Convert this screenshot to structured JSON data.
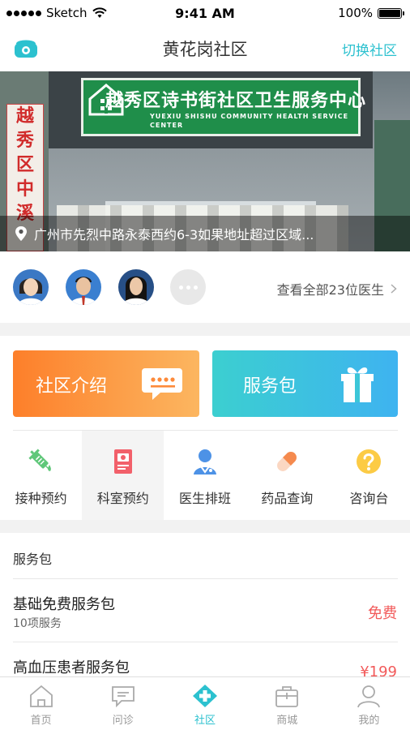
{
  "status_bar": {
    "carrier": "Sketch",
    "time": "9:41 AM",
    "battery": "100%"
  },
  "nav": {
    "title": "黄花岗社区",
    "switch_label": "切换社区",
    "phone_icon": "phone-icon"
  },
  "banner": {
    "address": "广州市先烈中路永泰西约6-3如果地址超过区域...",
    "sign_cn": "越秀区诗书街社区卫生服务中心",
    "sign_en": "YUEXIU SHISHU COMMUNITY HEALTH SERVICE CENTER",
    "side_banner": [
      "越",
      "秀",
      "区",
      "中",
      "溪"
    ]
  },
  "doctors": {
    "see_all": "查看全部23位医生"
  },
  "cards": {
    "intro_label": "社区介绍",
    "package_label": "服务包"
  },
  "menu": [
    {
      "label": "接种预约",
      "icon": "syringe-icon"
    },
    {
      "label": "科室预约",
      "icon": "notebook-icon"
    },
    {
      "label": "医生排班",
      "icon": "doctor-icon"
    },
    {
      "label": "药品查询",
      "icon": "pill-icon"
    },
    {
      "label": "咨询台",
      "icon": "question-icon"
    }
  ],
  "services": {
    "section_title": "服务包",
    "items": [
      {
        "name": "基础免费服务包",
        "sub": "10项服务",
        "price": "免费"
      },
      {
        "name": "高血压患者服务包",
        "sub": "",
        "price": "¥199"
      }
    ]
  },
  "tabs": [
    {
      "label": "首页",
      "icon": "home-icon"
    },
    {
      "label": "问诊",
      "icon": "chat-icon"
    },
    {
      "label": "社区",
      "icon": "community-icon"
    },
    {
      "label": "商城",
      "icon": "shop-icon"
    },
    {
      "label": "我的",
      "icon": "profile-icon"
    }
  ],
  "colors": {
    "accent": "#2cc1cf",
    "price": "#f25a5a",
    "intro_card": "#fd7f2a",
    "package_card": "#3cc3e0"
  }
}
